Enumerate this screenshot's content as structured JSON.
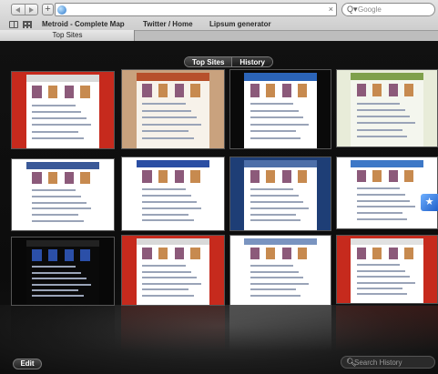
{
  "toolbar": {
    "url": "",
    "search_placeholder": "Google",
    "clear_icon": "×",
    "search_icon": "Q▾",
    "add_label": "+"
  },
  "bookmarks": {
    "items": [
      {
        "label": "Metroid - Complete Map"
      },
      {
        "label": "Twitter / Home"
      },
      {
        "label": "Lipsum generator"
      }
    ]
  },
  "tab": {
    "label": "Top Sites"
  },
  "topsites": {
    "segments": [
      {
        "label": "Top Sites",
        "active": true
      },
      {
        "label": "History",
        "active": false
      }
    ],
    "new_badge": "★",
    "edit_label": "Edit",
    "search_history_placeholder": "Search History",
    "search_history_icon": "🔍︎"
  },
  "sites": [
    {
      "name": "site-1",
      "bg": "#c62a1d",
      "page": "#ffffff",
      "hdr": "#d9d9d9"
    },
    {
      "name": "site-2",
      "bg": "#c9a27e",
      "page": "#f7f2ea",
      "hdr": "#b7502b"
    },
    {
      "name": "site-3",
      "bg": "#0a0a0a",
      "page": "#ffffff",
      "hdr": "#2b64b8"
    },
    {
      "name": "site-4",
      "bg": "#e8ecd9",
      "page": "#f4f6ee",
      "hdr": "#7fa04b"
    },
    {
      "name": "site-5",
      "bg": "#ffffff",
      "page": "#ffffff",
      "hdr": "#3b5998"
    },
    {
      "name": "site-6",
      "bg": "#ffffff",
      "page": "#ffffff",
      "hdr": "#2a4ea3"
    },
    {
      "name": "site-7",
      "bg": "#1e3e76",
      "page": "#ffffff",
      "hdr": "#4d6fa9"
    },
    {
      "name": "site-8",
      "bg": "#ffffff",
      "page": "#ffffff",
      "hdr": "#3d78c7"
    },
    {
      "name": "site-9",
      "bg": "#080808",
      "page": "#0a0a0a",
      "hdr": "#222222"
    },
    {
      "name": "site-10",
      "bg": "#c62a1d",
      "page": "#ffffff",
      "hdr": "#d9d9d9"
    },
    {
      "name": "site-11",
      "bg": "#ffffff",
      "page": "#ffffff",
      "hdr": "#7a94c0"
    },
    {
      "name": "site-12",
      "bg": "#c62a1d",
      "page": "#ffffff",
      "hdr": "#e1e1e1"
    }
  ]
}
